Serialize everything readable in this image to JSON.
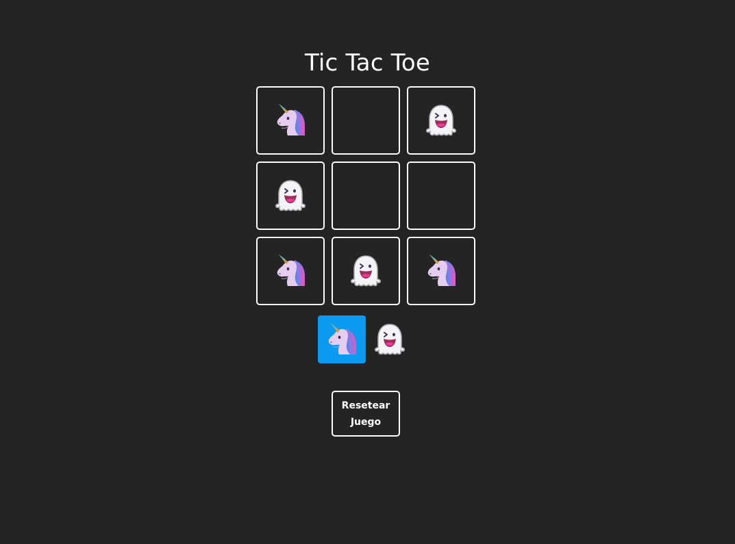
{
  "title": "Tic Tac Toe",
  "board": [
    "unicorn",
    "",
    "ghost",
    "ghost",
    "",
    "",
    "unicorn",
    "ghost",
    "unicorn"
  ],
  "turn": {
    "players": [
      "unicorn",
      "ghost"
    ],
    "current": "unicorn"
  },
  "reset_label": "Resetear Juego",
  "colors": {
    "background": "#242424",
    "border": "#ffffff",
    "active_turn": "#0a9af0"
  },
  "icons": {
    "unicorn": "unicorn-icon",
    "ghost": "ghost-icon"
  }
}
